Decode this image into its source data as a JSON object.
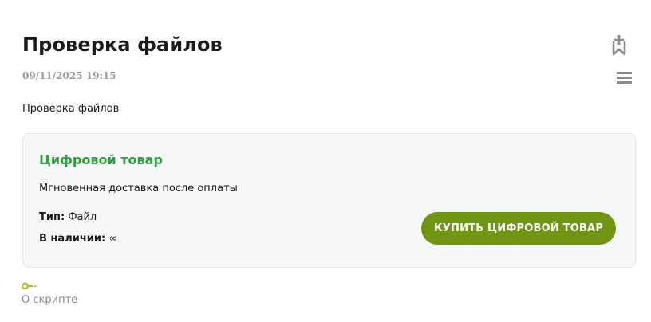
{
  "post": {
    "title": "Проверка файлов",
    "date": "09/11/2025 19:15",
    "description": "Проверка файлов"
  },
  "actions": {
    "bookmark_icon": "bookmark-add-icon",
    "menu_icon": "hamburger-menu-icon"
  },
  "product": {
    "title": "Цифровой товар",
    "subtitle": "Мгновенная доставка после оплаты",
    "type_label": "Тип:",
    "type_value": "Файл",
    "stock_label": "В наличии:",
    "stock_value": "∞",
    "buy_label": "Купить цифровой товар"
  },
  "footer": {
    "script_icon": "key-icon",
    "script_link": "О скрипте"
  },
  "colors": {
    "accent_green": "#2e9e3e",
    "button_green": "#6f9513",
    "icon_gray": "#8a8a8a",
    "key_icon": "#a6c423"
  }
}
